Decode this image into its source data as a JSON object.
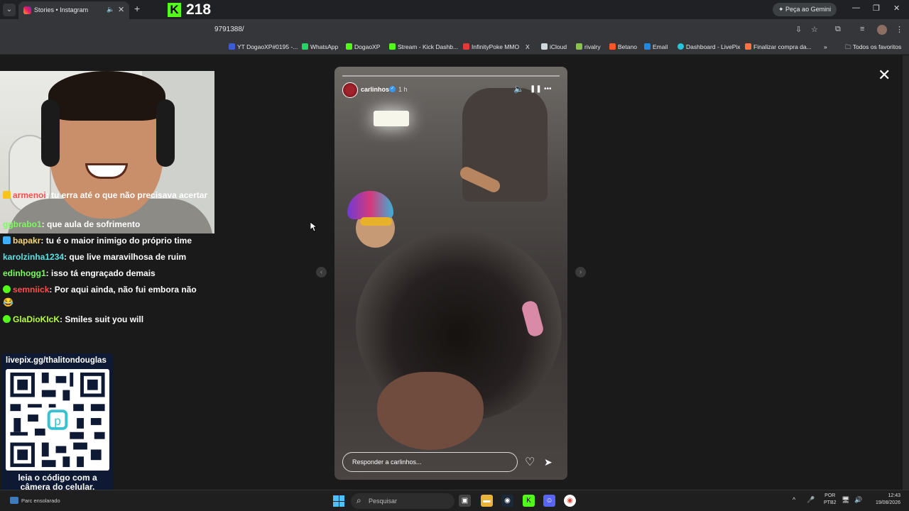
{
  "browser": {
    "tab_title": "Stories • Instagram",
    "url_fragment": "9791388/",
    "gemini_label": "Peça ao Gemini",
    "new_tab_glyph": "+",
    "win_controls": [
      "—",
      "❐",
      "✕"
    ]
  },
  "kick_overlay": {
    "logo": "K",
    "viewer_count": "218"
  },
  "bookmarks": [
    {
      "label": "YT DogaoXP#0195 -...",
      "color": "#3b5bdb"
    },
    {
      "label": "WhatsApp",
      "color": "#25d366"
    },
    {
      "label": "DogaoXP",
      "color": "#53fc18"
    },
    {
      "label": "Stream - Kick Dashb...",
      "color": "#53fc18"
    },
    {
      "label": "InfinityPoke MMO",
      "color": "#e53935"
    },
    {
      "label": "X",
      "color": "#000000"
    },
    {
      "label": "iCloud",
      "color": "#ffffff"
    },
    {
      "label": "rivalry",
      "color": "#8bc34a"
    },
    {
      "label": "Betano",
      "color": "#ff5722"
    },
    {
      "label": "Email",
      "color": "#1e88e5"
    },
    {
      "label": "Dashboard - LivePix",
      "color": "#26c6da"
    },
    {
      "label": "Finalizar compra da...",
      "color": "#ff7043"
    },
    {
      "label": "»",
      "color": ""
    },
    {
      "label": "Todos os favoritos",
      "color": ""
    }
  ],
  "chat": {
    "messages": [
      {
        "user": "armenoi",
        "text": ": tu erra até o que não precisava acertar",
        "user_color": "#ff4d4d",
        "badge_color": "#f5c518"
      },
      {
        "user": "ggbrabo1",
        "text": ": que aula de sofrimento",
        "user_color": "#7cfc5c",
        "badge_color": ""
      },
      {
        "user": "bapakr",
        "text": ": tu é o maior inimigo do próprio time",
        "user_color": "#f5d76e",
        "badge_color": "#3ab0ff"
      },
      {
        "user": "karolzinha1234",
        "text": ": que live maravilhosa de ruim",
        "user_color": "#5ce1e6",
        "badge_color": ""
      },
      {
        "user": "edinhogg1",
        "text": ": isso tá engraçado demais",
        "user_color": "#7cfc5c",
        "badge_color": ""
      },
      {
        "user": "semniick",
        "text": ": Por aqui ainda, não fui embora não 😂",
        "user_color": "#ff4d4d",
        "badge_color": "#53fc18"
      },
      {
        "user": "GlaDioKIcK",
        "text": ": Smiles suit you will",
        "user_color": "#b6ff3b",
        "badge_color": "#53fc18"
      }
    ]
  },
  "qr": {
    "url": "livepix.gg/thalitondouglas",
    "caption": "leia o código com a câmera do celular."
  },
  "story": {
    "username": "carlinhos",
    "verified_glyph": "✓",
    "time": "1 h",
    "reply_placeholder": "Responder a carlinhos...",
    "mute_glyph": "🔈",
    "pause_glyph": "❚❚",
    "more_glyph": "•••",
    "heart_glyph": "♡",
    "send_glyph": "➤",
    "prev_glyph": "‹",
    "next_glyph": "›",
    "close_glyph": "✕"
  },
  "taskbar": {
    "weather_text": "Parc ensolarado",
    "search_placeholder": "Pesquisar",
    "search_glyph": "⌕",
    "lang_line1": "POR",
    "lang_line2": "PTB2",
    "time": "12:43",
    "date": "19/08/2026",
    "tray_glyphs": [
      "^",
      "🎤",
      "🖥",
      "🔊"
    ]
  }
}
